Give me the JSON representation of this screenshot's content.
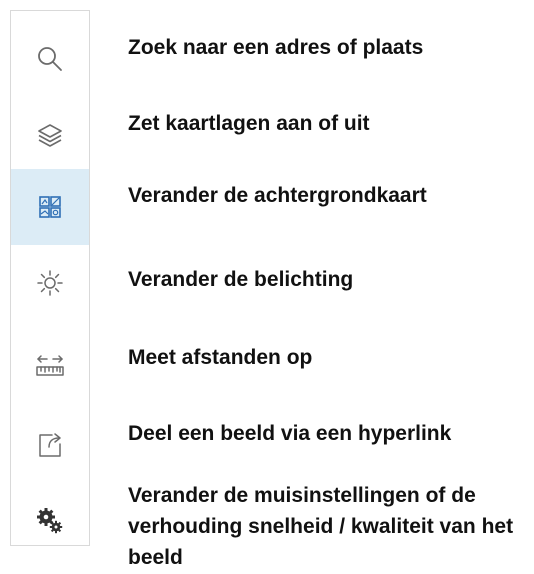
{
  "toolbar": {
    "tools": [
      {
        "icon": "search-icon",
        "label": "Zoek naar een adres of plaats",
        "active": false
      },
      {
        "icon": "layers-icon",
        "label": "Zet kaartlagen aan of uit",
        "active": false
      },
      {
        "icon": "basemap-grid-icon",
        "label": "Verander de achtergrondkaart",
        "active": true
      },
      {
        "icon": "sun-icon",
        "label": "Verander de belichting",
        "active": false
      },
      {
        "icon": "measure-ruler-icon",
        "label": "Meet afstanden op",
        "active": false
      },
      {
        "icon": "share-icon",
        "label": "Deel een beeld via een hyperlink",
        "active": false
      },
      {
        "icon": "gears-icon",
        "label": "Verander de muisinstellingen of de verhouding snelheid / kwaliteit van het beeld",
        "active": false
      }
    ]
  },
  "colors": {
    "active_background": "#dcecf6",
    "active_icon": "#2f6fb5",
    "icon": "#6b6b6b",
    "border": "#d9d9d9",
    "text": "#111111"
  }
}
